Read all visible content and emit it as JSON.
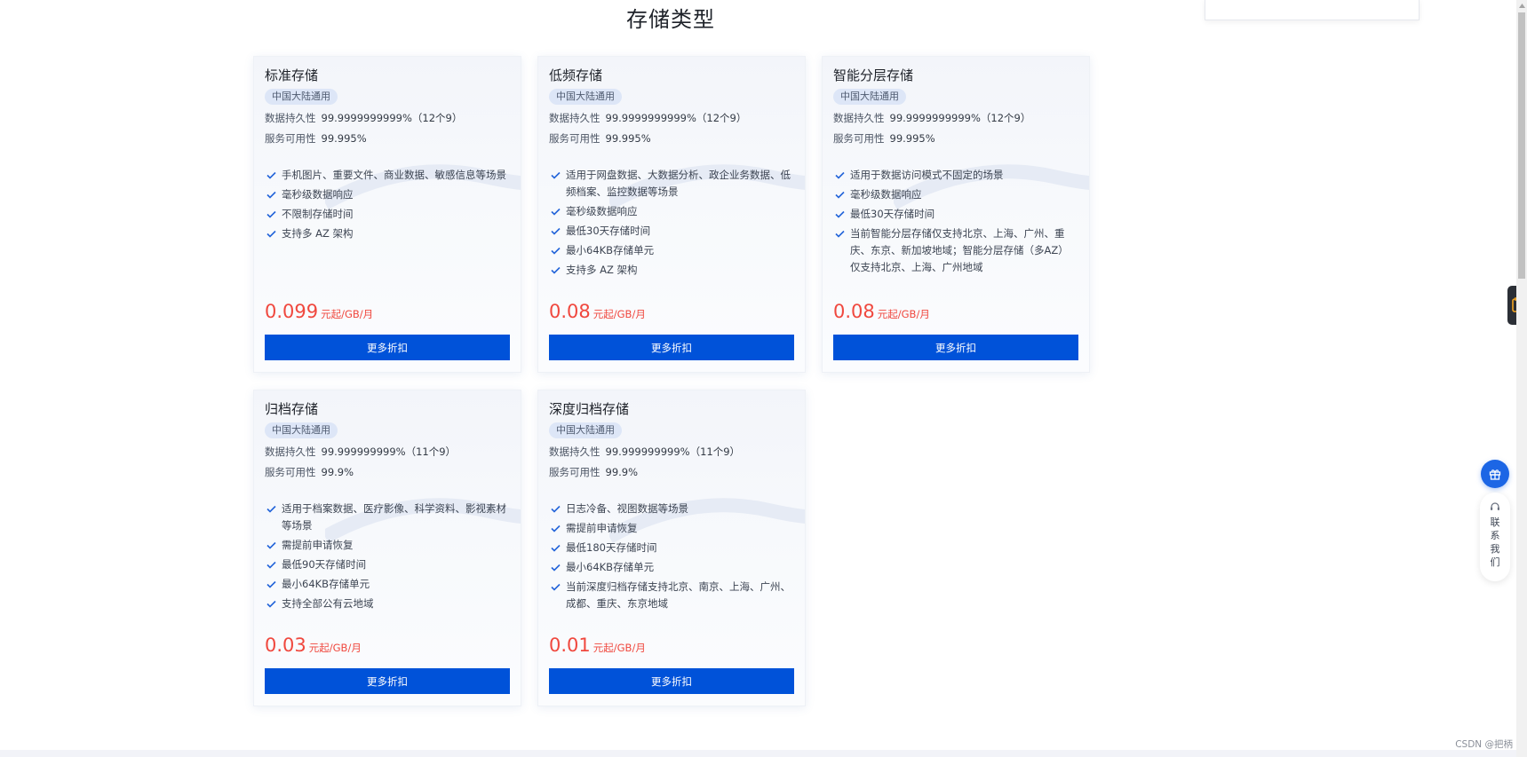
{
  "page": {
    "title": "存储类型"
  },
  "common": {
    "durability_label": "数据持久性",
    "availability_label": "服务可用性"
  },
  "cards": [
    {
      "title": "标准存储",
      "region_tag": "中国大陆通用",
      "durability": "99.9999999999%（12个9）",
      "availability": "99.995%",
      "features": [
        "手机图片、重要文件、商业数据、敏感信息等场景",
        "毫秒级数据响应",
        "不限制存储时间",
        "支持多 AZ 架构"
      ],
      "price": "0.099",
      "price_unit": "元起/GB/月",
      "button": "更多折扣"
    },
    {
      "title": "低频存储",
      "region_tag": "中国大陆通用",
      "durability": "99.9999999999%（12个9）",
      "availability": "99.995%",
      "features": [
        "适用于网盘数据、大数据分析、政企业务数据、低频档案、监控数据等场景",
        "毫秒级数据响应",
        "最低30天存储时间",
        "最小64KB存储单元",
        "支持多 AZ 架构"
      ],
      "price": "0.08",
      "price_unit": "元起/GB/月",
      "button": "更多折扣"
    },
    {
      "title": "智能分层存储",
      "region_tag": "中国大陆通用",
      "durability": "99.9999999999%（12个9）",
      "availability": "99.995%",
      "features": [
        "适用于数据访问模式不固定的场景",
        "毫秒级数据响应",
        "最低30天存储时间",
        "当前智能分层存储仅支持北京、上海、广州、重庆、东京、新加坡地域；智能分层存储（多AZ）仅支持北京、上海、广州地域"
      ],
      "price": "0.08",
      "price_unit": "元起/GB/月",
      "button": "更多折扣"
    },
    {
      "title": "归档存储",
      "region_tag": "中国大陆通用",
      "durability": "99.999999999%（11个9）",
      "availability": "99.9%",
      "features": [
        "适用于档案数据、医疗影像、科学资料、影视素材等场景",
        "需提前申请恢复",
        "最低90天存储时间",
        "最小64KB存储单元",
        "支持全部公有云地域"
      ],
      "price": "0.03",
      "price_unit": "元起/GB/月",
      "button": "更多折扣"
    },
    {
      "title": "深度归档存储",
      "region_tag": "中国大陆通用",
      "durability": "99.999999999%（11个9）",
      "availability": "99.9%",
      "features": [
        "日志冷备、视图数据等场景",
        "需提前申请恢复",
        "最低180天存储时间",
        "最小64KB存储单元",
        "当前深度归档存储支持北京、南京、上海、广州、成都、重庆、东京地域"
      ],
      "price": "0.01",
      "price_unit": "元起/GB/月",
      "button": "更多折扣"
    }
  ],
  "sidebar": {
    "contact_label": "联系我们"
  },
  "watermark": "CSDN @把柄",
  "colors": {
    "primary": "#0052d9",
    "price": "#f0483e",
    "tag_bg": "#dde6f7",
    "check": "#2364d9"
  },
  "icons": {
    "check": "check-icon",
    "gift": "gift-icon",
    "headset": "headset-icon",
    "side_tab": "cup-icon"
  }
}
